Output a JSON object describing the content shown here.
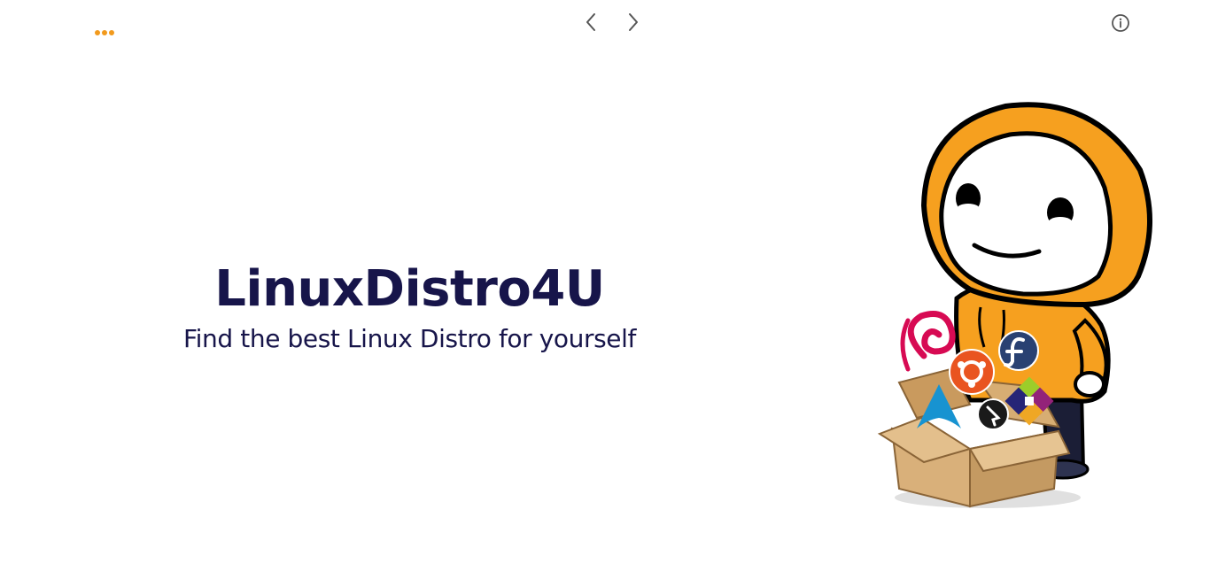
{
  "toolbar": {
    "menu_icon": "more-horizontal-icon",
    "prev_icon": "chevron-left-icon",
    "next_icon": "chevron-right-icon",
    "info_icon": "info-circle-icon"
  },
  "hero": {
    "title": "LinuxDistro4U",
    "subtitle": "Find the best Linux Distro for yourself"
  },
  "illustration": {
    "name": "hooded-mascot-with-distro-box",
    "logos": [
      "debian-logo",
      "ubuntu-logo",
      "fedora-logo",
      "arch-logo",
      "centos-logo",
      "elementary-logo"
    ]
  },
  "colors": {
    "accent": "#f29a1d",
    "title_text": "#17154a",
    "icon_gray": "#555555",
    "hood_orange": "#f6a01f",
    "box_tan": "#d9b07a"
  }
}
